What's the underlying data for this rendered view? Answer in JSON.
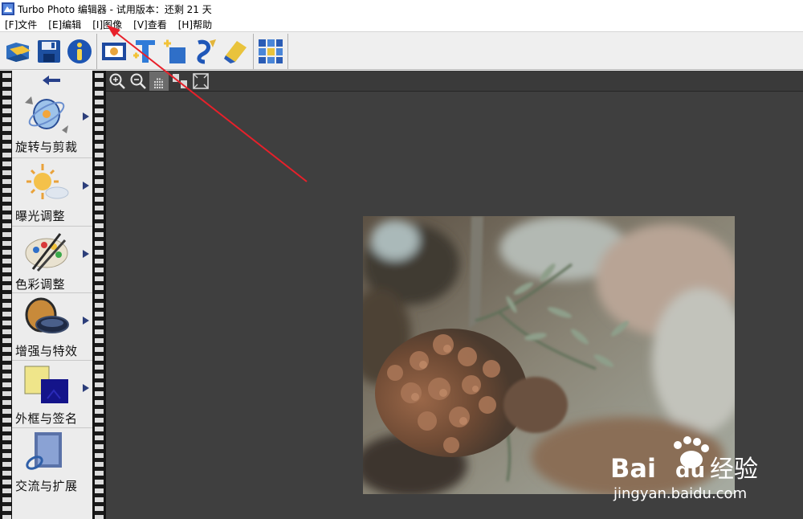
{
  "window": {
    "title": "Turbo Photo 编辑器 - 试用版本：还剩 21 天"
  },
  "menu": [
    {
      "label": "[F]文件"
    },
    {
      "label": "[E]编辑"
    },
    {
      "label": "[I]图像"
    },
    {
      "label": "[V]查看"
    },
    {
      "label": "[H]帮助"
    }
  ],
  "toolbar": {
    "groups": [
      [
        "open-icon",
        "save-icon",
        "info-icon"
      ],
      [
        "image-frame-icon",
        "add-text-icon",
        "add-layer-icon",
        "brush-icon",
        "eraser-icon"
      ],
      [
        "grid-mosaic-icon"
      ]
    ]
  },
  "side_panel": {
    "items": [
      {
        "label": "旋转与剪裁",
        "icon": "rotate-crop-icon"
      },
      {
        "label": "曝光调整",
        "icon": "exposure-sun-icon"
      },
      {
        "label": "色彩调整",
        "icon": "color-palette-icon"
      },
      {
        "label": "增强与特效",
        "icon": "lens-filter-icon"
      },
      {
        "label": "外框与签名",
        "icon": "frame-signature-icon"
      },
      {
        "label": "交流与扩展",
        "icon": "share-extend-icon"
      }
    ]
  },
  "canvas_toolbar": [
    "zoom-in-icon",
    "zoom-out-icon",
    "pan-icon",
    "fit-icon",
    "fullscreen-icon"
  ],
  "watermark": {
    "brand": "Bai",
    "brand2": "du",
    "brand3": "经验",
    "url": "jingyan.baidu.com"
  },
  "colors": {
    "canvas_bg": "#3f3f3f",
    "panel_bg": "#ececec",
    "annotation": "#e8202a"
  }
}
